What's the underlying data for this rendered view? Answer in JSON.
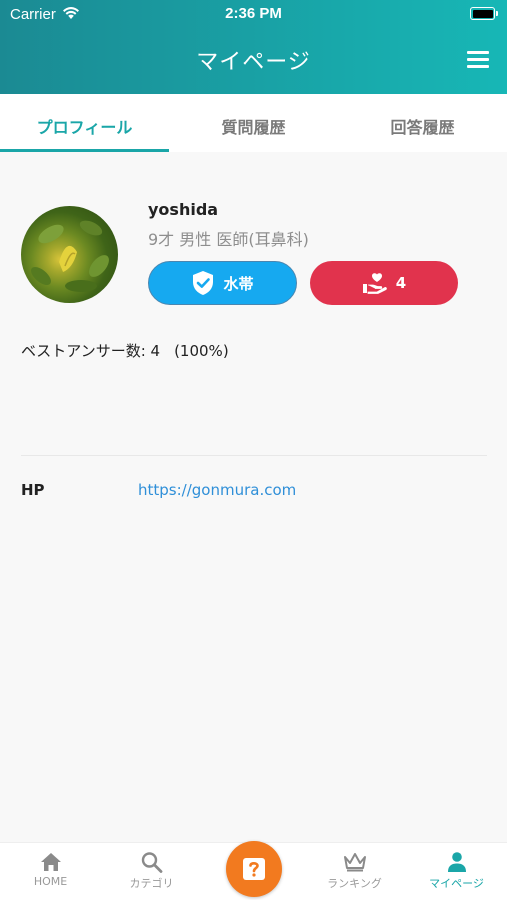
{
  "status_bar": {
    "carrier": "Carrier",
    "time": "2:36 PM"
  },
  "header": {
    "title": "マイページ",
    "menu_icon": "hamburger-menu-icon"
  },
  "tabs": [
    {
      "label": "プロフィール",
      "active": true
    },
    {
      "label": "質問履歴",
      "active": false
    },
    {
      "label": "回答履歴",
      "active": false
    }
  ],
  "profile": {
    "username": "yoshida",
    "meta": "9才 男性 医師(耳鼻科)",
    "badge_water": {
      "label": "水帯",
      "icon": "shield-check-icon",
      "color": "#16a9f0"
    },
    "badge_like": {
      "count": "4",
      "icon": "heart-hand-icon",
      "color": "#e1334d"
    },
    "best_answer_label": "ベストアンサー数: 4",
    "best_answer_pct": "(100%)",
    "hp_label": "HP",
    "hp_url": "https://gonmura.com"
  },
  "bottom_nav": {
    "home": "HOME",
    "category": "カテゴリ",
    "ask_icon": "question-icon",
    "ranking": "ランキング",
    "mypage": "マイページ",
    "accent": "#1aa6a8",
    "center_color": "#f27a1f"
  }
}
